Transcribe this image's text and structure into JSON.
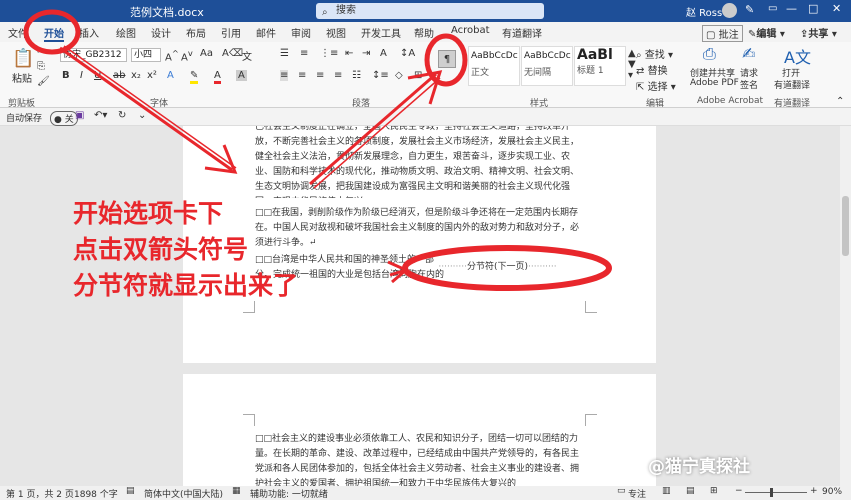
{
  "title_bar": {
    "doc_name": "范例文档.docx",
    "search_placeholder": "搜索",
    "user": "赵 Ross",
    "minimize": "—",
    "restore": "□",
    "close": "✕"
  },
  "tabs": [
    "文件",
    "开始",
    "插入",
    "绘图",
    "设计",
    "布局",
    "引用",
    "邮件",
    "审阅",
    "视图",
    "开发工具",
    "帮助",
    "Acrobat",
    "有道翻译"
  ],
  "tab_right": {
    "annotate": "批注",
    "edit": "编辑",
    "share": "共享"
  },
  "ribbon": {
    "clipboard": {
      "paste": "粘贴",
      "label": "剪贴板"
    },
    "font": {
      "name": "仿宋_GB2312",
      "size": "小四",
      "label": "字体",
      "bold": "B",
      "italic": "I",
      "underline": "U"
    },
    "paragraph": {
      "label": "段落"
    },
    "styles": {
      "label": "样式",
      "items": [
        {
          "sample": "AaBbCcDc",
          "name": "正文"
        },
        {
          "sample": "AaBbCcDc",
          "name": "无间隔"
        },
        {
          "sample": "AaBl",
          "name": "标题 1"
        }
      ]
    },
    "editing": {
      "find": "查找",
      "replace": "替换",
      "select": "选择",
      "label": "编辑"
    },
    "acrobat": {
      "create": "创建并共享",
      "create2": "Adobe PDF",
      "sign": "请求",
      "sign2": "签名",
      "label": "Adobe Acrobat"
    },
    "youdao": {
      "open": "打开",
      "open2": "有道翻译",
      "label": "有道翻译"
    }
  },
  "qat": {
    "autosave": "自动保存",
    "toggle": "关"
  },
  "document": {
    "para1": "已社会主义制度正在确立，全国人民民主专政，坚持社会主义道路，坚持改革开放，不断完善社会主义的各项制度，发展社会主义市场经济，发展社会主义民主，健全社会主义法治，贯彻新发展理念，自力更生，艰苦奋斗，逐步实现工业、农业、国防和科学技术的现代化，推动物质文明、政治文明、精神文明、社会文明、生态文明协调发展，把我国建设成为富强民主文明和谐美丽的社会主义现代化强国，实现中华民族伟大复兴。↵",
    "para2": "□□在我国，剥削阶级作为阶级已经消灭，但是阶级斗争还将在一定范围内长期存在。中国人民对敌视和破坏我国社会主义制度的国内外的敌对势力和敌对分子，必须进行斗争。↵",
    "para3": "□□台湾是中华人民共和国的神圣领土的一部分。完成统一祖国的大业是包括台湾同胞在内的全中国人民的神圣职责。",
    "section_break": "分节符(下一页)",
    "para4": "□□社会主义的建设事业必须依靠工人、农民和知识分子，团结一切可以团结的力量。在长期的革命、建设、改革过程中，已经结成由中国共产党领导的，有各民主党派和各人民团体参加的，包括全体社会主义劳动者、社会主义事业的建设者、拥护社会主义的爱国者、拥护祖国统一和致力于中华民族伟大复兴的"
  },
  "annotation": {
    "line1": "开始选项卡下",
    "line2": "点击双箭头符号",
    "line3": "分节符就显示出来了",
    "color": "#e8272c"
  },
  "status": {
    "page": "第 1 页，共 2 页",
    "words": "1898 个字",
    "lang": "简体中文(中国大陆)",
    "access": "辅助功能: 一切就绪",
    "focus": "专注",
    "zoom": "90%"
  },
  "watermark": "@猫宁真探社"
}
